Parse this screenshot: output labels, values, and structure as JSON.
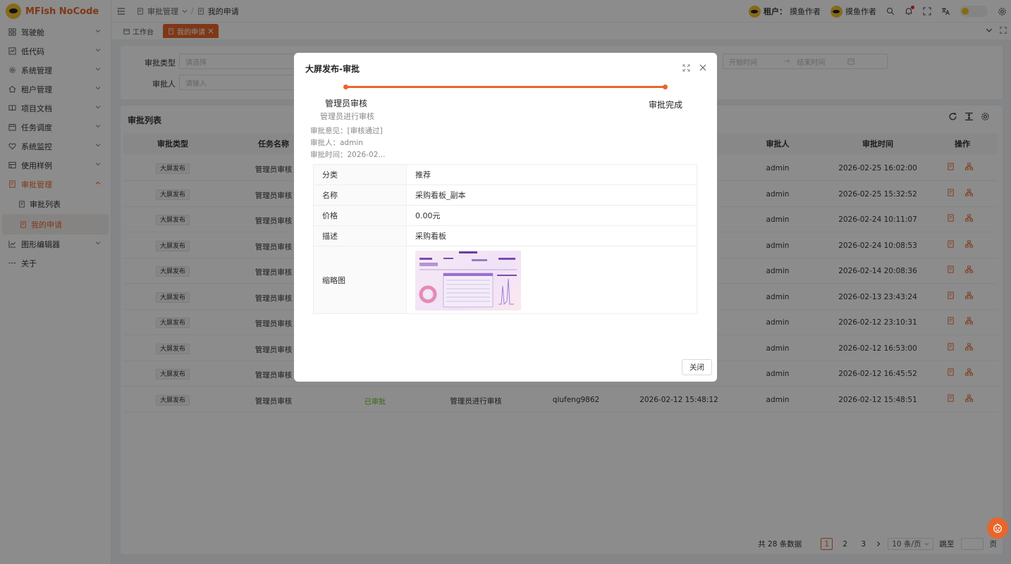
{
  "app": {
    "name": "MFish NoCode"
  },
  "sidebar": {
    "items": [
      {
        "label": "驾驶舱",
        "icon": "dashboard-icon"
      },
      {
        "label": "低代码",
        "icon": "code-icon"
      },
      {
        "label": "系统管理",
        "icon": "gear-icon"
      },
      {
        "label": "租户管理",
        "icon": "home-icon"
      },
      {
        "label": "项目文档",
        "icon": "book-icon"
      },
      {
        "label": "任务调度",
        "icon": "calendar-icon"
      },
      {
        "label": "系统监控",
        "icon": "heartbeat-icon"
      },
      {
        "label": "使用样例",
        "icon": "grid-icon"
      },
      {
        "label": "审批管理",
        "icon": "audit-icon"
      },
      {
        "label": "图形编辑器",
        "icon": "chart-icon"
      },
      {
        "label": "关于",
        "icon": "dots-icon"
      }
    ],
    "sub_items": [
      {
        "label": "审批列表"
      },
      {
        "label": "我的申请"
      }
    ]
  },
  "header": {
    "breadcrumb": [
      "审批管理",
      "我的申请"
    ],
    "tenant_label": "租户：",
    "tenant_name": "摸鱼作者",
    "user_name": "摸鱼作者"
  },
  "tabs": [
    {
      "label": "工作台"
    },
    {
      "label": "我的申请"
    }
  ],
  "filter": {
    "type_label": "审批类型",
    "type_placeholder": "请选择",
    "approver_label": "审批人",
    "approver_placeholder": "请输入",
    "start_placeholder": "开始时间",
    "end_placeholder": "结束时间"
  },
  "table": {
    "title": "审批列表",
    "columns": [
      "审批类型",
      "任务名称",
      "审批人",
      "审批时间",
      "操作"
    ],
    "rows": [
      {
        "type": "大屏发布",
        "task": "管理员审核",
        "approver": "admin",
        "time": "2026-02-25 16:02:00"
      },
      {
        "type": "大屏发布",
        "task": "管理员审核",
        "approver": "admin",
        "time": "2026-02-25 15:32:52"
      },
      {
        "type": "大屏发布",
        "task": "管理员审核",
        "approver": "admin",
        "time": "2026-02-24 10:11:07"
      },
      {
        "type": "大屏发布",
        "task": "管理员审核",
        "approver": "admin",
        "time": "2026-02-24 10:08:53"
      },
      {
        "type": "大屏发布",
        "task": "管理员审核",
        "approver": "admin",
        "time": "2026-02-14 20:08:36"
      },
      {
        "type": "大屏发布",
        "task": "管理员审核",
        "approver": "admin",
        "time": "2026-02-13 23:43:24"
      },
      {
        "type": "大屏发布",
        "task": "管理员审核",
        "approver": "admin",
        "time": "2026-02-12 23:10:31"
      },
      {
        "type": "大屏发布",
        "task": "管理员审核",
        "approver": "admin",
        "time": "2026-02-12 16:53:00"
      },
      {
        "type": "大屏发布",
        "task": "管理员审核",
        "approver": "admin",
        "time": "2026-02-12 16:45:52"
      }
    ],
    "last_row": {
      "type": "大屏发布",
      "task": "管理员审核",
      "status": "已审批",
      "desc": "管理员进行审核",
      "applicant": "qiufeng9862",
      "apply_time": "2026-02-12 15:48:12",
      "approver": "admin",
      "time": "2026-02-12 15:48:51"
    }
  },
  "pagination": {
    "total": "共 28 条数据",
    "pages": [
      "1",
      "2",
      "3"
    ],
    "page_size": "10 条/页",
    "jump_label": "跳至",
    "page_suffix": "页"
  },
  "modal": {
    "title": "大屏发布-审批",
    "steps": [
      {
        "title": "管理员审核",
        "desc": "管理员进行审核"
      },
      {
        "title": "审批完成"
      }
    ],
    "opinion": "审批意见：[审核通过]",
    "approver": "审批人：admin",
    "approve_time": "审批时间：2026-02...",
    "fields": [
      {
        "key": "分类",
        "value": "推荐"
      },
      {
        "key": "名称",
        "value": "采购看板_副本"
      },
      {
        "key": "价格",
        "value": "0.00元"
      },
      {
        "key": "描述",
        "value": "采购看板"
      }
    ],
    "thumbnail_label": "缩略图",
    "close_label": "关闭"
  },
  "colors": {
    "accent": "#e8662b",
    "success": "#52c41a"
  }
}
